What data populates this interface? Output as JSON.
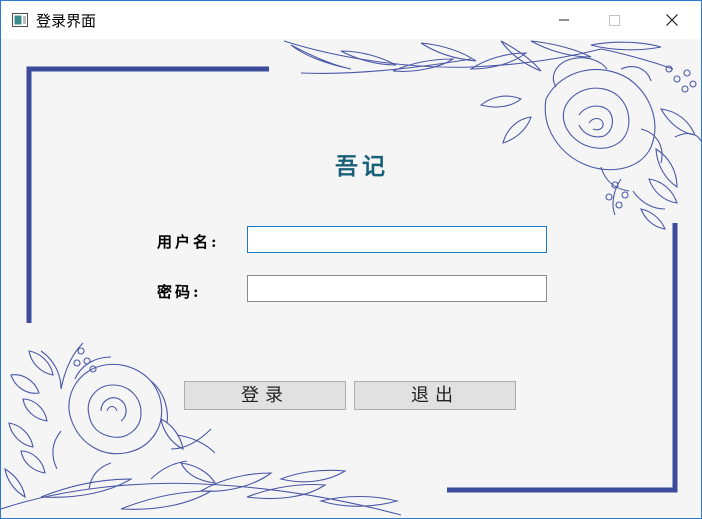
{
  "window": {
    "title": "登录界面",
    "icon": "app-window-icon",
    "controls": [
      "minimize-icon",
      "maximize-icon",
      "close-icon"
    ]
  },
  "form": {
    "heading": "吾记",
    "username_label": "用户名:",
    "username_value": "",
    "password_label": "密码:",
    "password_value": ""
  },
  "buttons": {
    "login_label": "登录",
    "exit_label": "退出"
  },
  "colors": {
    "frame": "#3d4b9c",
    "heading": "#185f78",
    "floral": "#4a57a6",
    "background": "#f5f5f5"
  }
}
